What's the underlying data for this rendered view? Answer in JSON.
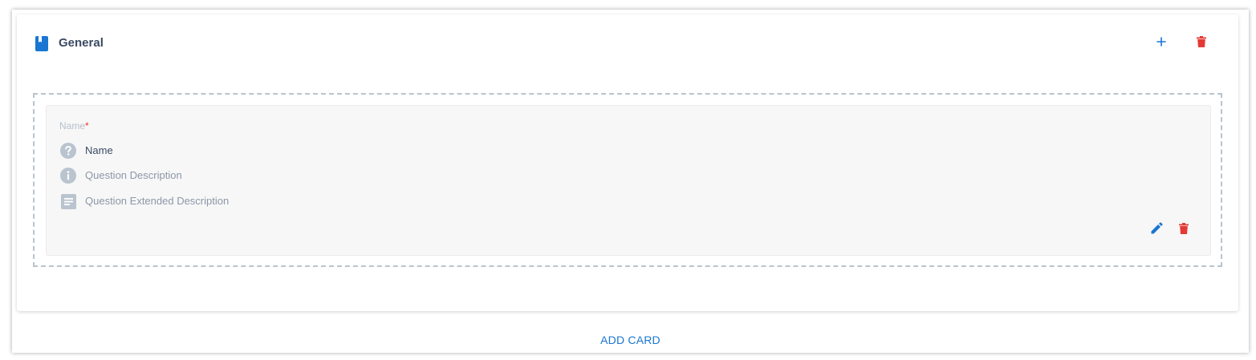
{
  "card": {
    "title": "General",
    "icon": "book-icon",
    "actions": {
      "add_icon": "plus-icon",
      "delete_icon": "trash-icon"
    }
  },
  "question": {
    "label": "Name",
    "required_marker": "*",
    "name": "Name",
    "description": "Question Description",
    "extended_description": "Question Extended Description",
    "icons": {
      "name": "help-circle-icon",
      "description": "info-icon",
      "extended_description": "notes-icon",
      "edit": "pencil-icon",
      "delete": "trash-icon"
    }
  },
  "footer": {
    "add_card_label": "ADD CARD"
  },
  "colors": {
    "accent": "#1976d2",
    "danger": "#e53935",
    "title": "#3a4a63",
    "muted": "#8c97a8",
    "icon_grey": "#b9c4cf"
  }
}
